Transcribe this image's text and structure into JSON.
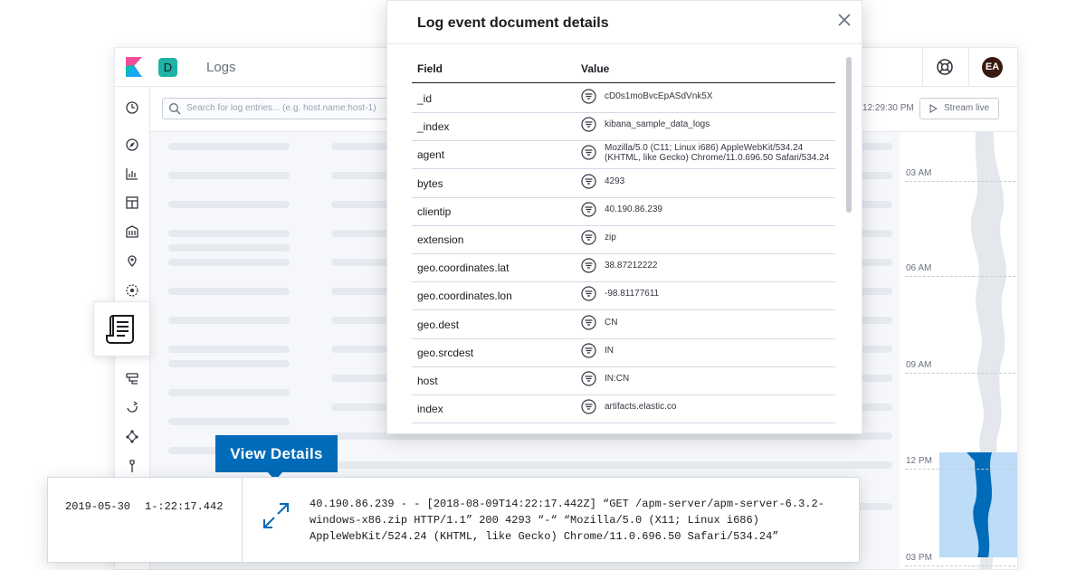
{
  "app": {
    "title": "Logs",
    "space_initial": "D",
    "user_initials": "EA",
    "search_placeholder": "Search for log entries... (e.g. host.name:host-1)",
    "time_display": "12:29:30 PM",
    "stream_live_label": "Stream live"
  },
  "nav_icons": [
    "clock-icon",
    "compass-icon",
    "chart-icon",
    "dashboard-icon",
    "canvas-icon",
    "maps-icon",
    "ml-icon",
    "logs-icon",
    "infra-icon",
    "apm-icon",
    "graph-icon",
    "devtools-icon"
  ],
  "minimap": {
    "ticks": [
      "03 AM",
      "06 AM",
      "09 AM",
      "12 PM",
      "03 PM"
    ]
  },
  "flyout": {
    "title": "Log event document details",
    "column_field": "Field",
    "column_value": "Value",
    "rows": [
      {
        "field": "_id",
        "value": "cD0s1moBvcEpASdVnk5X"
      },
      {
        "field": "_index",
        "value": "kibana_sample_data_logs"
      },
      {
        "field": "agent",
        "value": "Mozilla/5.0 (C11; Linux i686) AppleWebKit/534.24 (KHTML, like Gecko) Chrome/11.0.696.50 Safari/534.24"
      },
      {
        "field": "bytes",
        "value": "4293"
      },
      {
        "field": "clientip",
        "value": "40.190.86.239"
      },
      {
        "field": "extension",
        "value": "zip"
      },
      {
        "field": "geo.coordinates.lat",
        "value": "38.87212222"
      },
      {
        "field": "geo.coordinates.lon",
        "value": "-98.81177611"
      },
      {
        "field": "geo.dest",
        "value": "CN"
      },
      {
        "field": "geo.srcdest",
        "value": "IN"
      },
      {
        "field": "host",
        "value": "IN:CN"
      },
      {
        "field": "index",
        "value": "artifacts.elastic.co"
      }
    ]
  },
  "tooltip": {
    "label": "View Details"
  },
  "log_row": {
    "date": "2019-05-30",
    "time": "1-:22:17.442",
    "message": "40.190.86.239 - - [2018-08-09T14:22:17.442Z]  “GET  /apm-server/apm-server-6.3.2-windows-x86.zip HTTP/1.1”  200 4293  “-“ “Mozilla/5.0  (X11;  Linux  i686) AppleWebKit/524.24  (KHTML,  like Gecko)  Chrome/11.0.696.50 Safari/534.24”"
  },
  "colors": {
    "accent": "#006bb8",
    "highlight": "#bcdcf7",
    "space_badge": "#20b2a6",
    "avatar": "#3a1a10"
  }
}
